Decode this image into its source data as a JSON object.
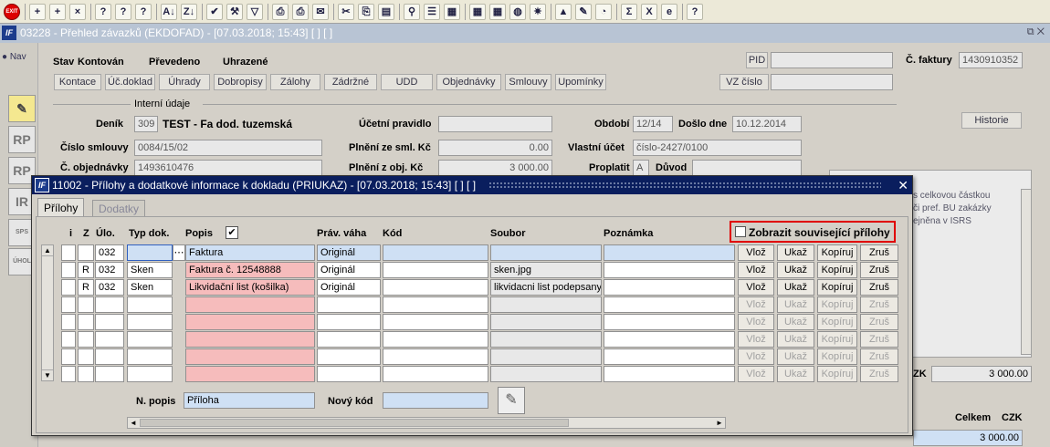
{
  "toolbar": {
    "exit_label": "EXIT",
    "icons": [
      "exit-icon",
      "new-record-icon",
      "new-copy-icon",
      "delete-record-icon",
      "query-icon",
      "query-run-icon",
      "query-cancel-icon",
      "sort-asc-icon",
      "sort-desc-icon",
      "confirm-icon",
      "wrench-icon",
      "filter-icon",
      "print-icon",
      "print-preview-icon",
      "mail-icon",
      "cut-icon",
      "copy-icon",
      "paste-icon",
      "zoom-icon",
      "list-icon",
      "grid-icon",
      "calculator-icon",
      "calendar-icon",
      "globe-icon",
      "wheel-icon",
      "hat-icon",
      "edit-icon",
      "clock-icon",
      "sum-icon",
      "excel-icon",
      "ie-icon",
      "help-icon"
    ],
    "glyphs": [
      "EXIT",
      "+",
      "+",
      "×",
      "?",
      "?",
      "?",
      "A↓",
      "Z↓",
      "✔",
      "⚒",
      "▽",
      "⎙",
      "⎙",
      "✉",
      "✂",
      "⎘",
      "▤",
      "⚲",
      "☰",
      "▦",
      "▦",
      "▦",
      "◍",
      "✷",
      "▲",
      "✎",
      "◔",
      "Σ",
      "X",
      "e",
      "?"
    ]
  },
  "main_window": {
    "logo": "IF",
    "title": "03228 - Přehled závazků (EKDOFAD) - [07.03.2018; 15:43]  [ ]  [ ]",
    "controls": "⧉ ✕"
  },
  "left_panel": {
    "nav_label": "Nav",
    "icons": [
      {
        "name": "pencil-icon",
        "glyph": "✎"
      },
      {
        "name": "rp-icon",
        "glyph": "RP"
      },
      {
        "name": "rp2-icon",
        "glyph": "RP"
      },
      {
        "name": "ir-icon",
        "glyph": "IR"
      },
      {
        "name": "sps-icon",
        "glyph": "SPS"
      },
      {
        "name": "uhol-icon",
        "glyph": "ÚHOL"
      }
    ]
  },
  "header": {
    "stav_label": "Stav",
    "stav_kontovan": "Kontován",
    "stav_prevedeno": "Převedeno",
    "stav_uhrazene": "Uhrazené",
    "pid_button": "PID",
    "cislo_faktury_label": "Č. faktury",
    "cislo_faktury_value": "1430910352",
    "buttons": [
      "Kontace",
      "Úč.doklad",
      "Úhrady",
      "Dobropisy",
      "Zálohy",
      "Zádržné",
      "UDD",
      "Objednávky",
      "Smlouvy",
      "Upomínky"
    ],
    "vz_cislo_button": "VZ číslo"
  },
  "interni": {
    "section_label": "Interní údaje",
    "denik_label": "Deník",
    "denik_value": "309",
    "denik_name": "TEST - Fa dod. tuzemská",
    "ucetni_pravidlo_label": "Účetní pravidlo",
    "obdobi_label": "Období",
    "obdobi_value": "12/14",
    "doslo_dne_label": "Došlo dne",
    "doslo_dne_value": "10.12.2014",
    "historie_button": "Historie",
    "cislo_smlouvy_label": "Číslo smlouvy",
    "cislo_smlouvy_value": "0084/15/02",
    "plneni_smlouvy_label": "Plnění ze sml. Kč",
    "plneni_smlouvy_value": "0.00",
    "vlastni_ucet_label": "Vlastní účet",
    "vlastni_ucet_value": "číslo-2427/0100",
    "cislo_objednavky_label": "Č. objednávky",
    "cislo_objednavky_value": "1493610476",
    "plneni_objednavky_label": "Plnění z obj. Kč",
    "plneni_objednavky_value": "3 000.00",
    "proplatit_label": "Proplatit",
    "proplatit_value": "A",
    "duvod_label": "Důvod"
  },
  "memo": {
    "lines": [
      "s celkovou částkou",
      "či pref. BU zakázky",
      "ejněna v ISRS"
    ]
  },
  "totals": {
    "czk_label": "ZK",
    "czk_value": "3 000.00",
    "celkem_label": "Celkem",
    "celkem_currency": "CZK",
    "celkem_value": "3 000.00"
  },
  "dialog": {
    "logo": "IF",
    "title": "11002 - Přílohy a dodatkové informace k dokladu (PRIUKAZ) - [07.03.2018; 15:43]  [ ]  [ ]",
    "close": "✕",
    "tabs": [
      "Přílohy",
      "Dodatky"
    ],
    "columns": {
      "i": "i",
      "z": "Z",
      "ulo": "Úlo.",
      "typ_dok": "Typ dok.",
      "popis": "Popis",
      "prav_vaha": "Práv. váha",
      "kod": "Kód",
      "soubor": "Soubor",
      "poznamka": "Poznámka"
    },
    "popis_check": "✔",
    "show_related_label": "Zobrazit související přílohy",
    "row_buttons": {
      "vloz": "Vlož",
      "ukaz": "Ukaž",
      "kopiruj": "Kopíruj",
      "zrus": "Zruš"
    },
    "rows": [
      {
        "i": "",
        "z": "",
        "ulo": "032",
        "typ_dok": "",
        "popis": "Faktura",
        "prav_vaha": "Originál",
        "kod": "",
        "soubor": "",
        "poznamka": ""
      },
      {
        "i": "",
        "z": "R",
        "ulo": "032",
        "typ_dok": "Sken",
        "popis": "Faktura č. 12548888",
        "prav_vaha": "Originál",
        "kod": "",
        "soubor": "sken.jpg",
        "poznamka": ""
      },
      {
        "i": "",
        "z": "R",
        "ulo": "032",
        "typ_dok": "Sken",
        "popis": "Likvidační list (košilka)",
        "prav_vaha": "Originál",
        "kod": "",
        "soubor": "likvidacni list podepsany.",
        "poznamka": ""
      },
      {
        "i": "",
        "z": "",
        "ulo": "",
        "typ_dok": "",
        "popis": "",
        "prav_vaha": "",
        "kod": "",
        "soubor": "",
        "poznamka": ""
      },
      {
        "i": "",
        "z": "",
        "ulo": "",
        "typ_dok": "",
        "popis": "",
        "prav_vaha": "",
        "kod": "",
        "soubor": "",
        "poznamka": ""
      },
      {
        "i": "",
        "z": "",
        "ulo": "",
        "typ_dok": "",
        "popis": "",
        "prav_vaha": "",
        "kod": "",
        "soubor": "",
        "poznamka": ""
      },
      {
        "i": "",
        "z": "",
        "ulo": "",
        "typ_dok": "",
        "popis": "",
        "prav_vaha": "",
        "kod": "",
        "soubor": "",
        "poznamka": ""
      },
      {
        "i": "",
        "z": "",
        "ulo": "",
        "typ_dok": "",
        "popis": "",
        "prav_vaha": "",
        "kod": "",
        "soubor": "",
        "poznamka": ""
      }
    ],
    "typ_dok_lookup": "⋯",
    "scroll_up": "▲",
    "scroll_down": "▼",
    "scroll_left": "◄",
    "scroll_right": "►",
    "n_popis_label": "N. popis",
    "n_popis_value": "Příloha",
    "novy_kod_label": "Nový kód",
    "novy_kod_value": "",
    "eraser_icon": "✎"
  },
  "colors": {
    "highlight_border": "#e00000",
    "pink_cell": "#f6bcbc",
    "blue_cell": "#cfe0f4",
    "dialog_title": "#0a1e5e"
  }
}
